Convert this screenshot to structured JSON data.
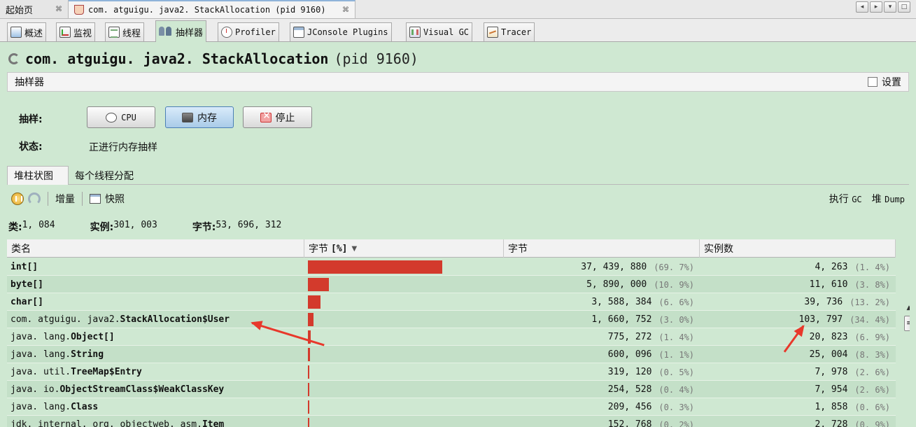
{
  "doc_tabs": {
    "home_label": "起始页",
    "home_close": "⌘",
    "active_label": "com. atguigu. java2. StackAllocation (pid 9160)",
    "active_close": "⌘"
  },
  "sub_tabs": [
    {
      "label": "概述",
      "icon": "info-icon"
    },
    {
      "label": "监视",
      "icon": "monitor-chart-icon"
    },
    {
      "label": "线程",
      "icon": "threads-icon"
    },
    {
      "label": "抽样器",
      "icon": "sampler-icon"
    },
    {
      "label": "Profiler",
      "icon": "profiler-clock-icon"
    },
    {
      "label": "JConsole Plugins",
      "icon": "jconsole-window-icon"
    },
    {
      "label": "Visual GC",
      "icon": "visual-gc-icon"
    },
    {
      "label": "Tracer",
      "icon": "tracer-icon"
    }
  ],
  "process": {
    "name": "com. atguigu. java2. StackAllocation",
    "pid": "(pid 9160)"
  },
  "sampler": {
    "title": "抽样器",
    "settings_label": "设置",
    "sample_label": "抽样:",
    "status_label": "状态:",
    "status_value": "正进行内存抽样",
    "buttons": {
      "cpu": "CPU",
      "memory": "内存",
      "stop": "停止"
    }
  },
  "view_tabs": {
    "histogram": "堆柱状图",
    "per_thread": "每个线程分配"
  },
  "toolbar": {
    "delta": "增量",
    "snapshot": "快照",
    "gc_prefix": "执行",
    "gc": "GC",
    "heap_prefix": "堆",
    "heap_dump": "Dump"
  },
  "summary": {
    "classes_label": "类:",
    "classes_value": "1, 084",
    "instances_label": "实例:",
    "instances_value": "301, 003",
    "bytes_label": "字节:",
    "bytes_value": "53, 696, 312"
  },
  "columns": {
    "name": "类名",
    "bytes_pct_prefix": "字节",
    "bytes_pct_suffix": "[%]",
    "bytes": "字节",
    "instances": "实例数"
  },
  "rows": [
    {
      "pkg": "",
      "cls": "int[]",
      "bytes": "37, 439, 880",
      "bytes_pct": "(69. 7%)",
      "share": 0.697,
      "instances": "4, 263",
      "inst_pct": "(1. 4%)"
    },
    {
      "pkg": "",
      "cls": "byte[]",
      "bytes": "5, 890, 000",
      "bytes_pct": "(10. 9%)",
      "share": 0.109,
      "instances": "11, 610",
      "inst_pct": "(3. 8%)"
    },
    {
      "pkg": "",
      "cls": "char[]",
      "bytes": "3, 588, 384",
      "bytes_pct": "(6. 6%)",
      "share": 0.066,
      "instances": "39, 736",
      "inst_pct": "(13. 2%)"
    },
    {
      "pkg": "com. atguigu. java2. ",
      "cls": "StackAllocation$User",
      "bytes": "1, 660, 752",
      "bytes_pct": "(3. 0%)",
      "share": 0.03,
      "instances": "103, 797",
      "inst_pct": "(34. 4%)"
    },
    {
      "pkg": "java. lang. ",
      "cls": "Object[]",
      "bytes": "775, 272",
      "bytes_pct": "(1. 4%)",
      "share": 0.014,
      "instances": "20, 823",
      "inst_pct": "(6. 9%)"
    },
    {
      "pkg": "java. lang. ",
      "cls": "String",
      "bytes": "600, 096",
      "bytes_pct": "(1. 1%)",
      "share": 0.011,
      "instances": "25, 004",
      "inst_pct": "(8. 3%)"
    },
    {
      "pkg": "java. util. ",
      "cls": "TreeMap$Entry",
      "bytes": "319, 120",
      "bytes_pct": "(0. 5%)",
      "share": 0.005,
      "instances": "7, 978",
      "inst_pct": "(2. 6%)"
    },
    {
      "pkg": "java. io. ",
      "cls": "ObjectStreamClass$WeakClassKey",
      "bytes": "254, 528",
      "bytes_pct": "(0. 4%)",
      "share": 0.004,
      "instances": "7, 954",
      "inst_pct": "(2. 6%)"
    },
    {
      "pkg": "java. lang. ",
      "cls": "Class",
      "bytes": "209, 456",
      "bytes_pct": "(0. 3%)",
      "share": 0.003,
      "instances": "1, 858",
      "inst_pct": "(0. 6%)"
    },
    {
      "pkg": "jdk. internal. org. objectweb. asm. ",
      "cls": "Item",
      "bytes": "152, 768",
      "bytes_pct": "(0. 2%)",
      "share": 0.002,
      "instances": "2, 728",
      "inst_pct": "(0. 9%)"
    }
  ],
  "colors": {
    "panel_bg": "#cfe8d2",
    "bar": "#d33a2c",
    "annotation": "#e8382b"
  }
}
